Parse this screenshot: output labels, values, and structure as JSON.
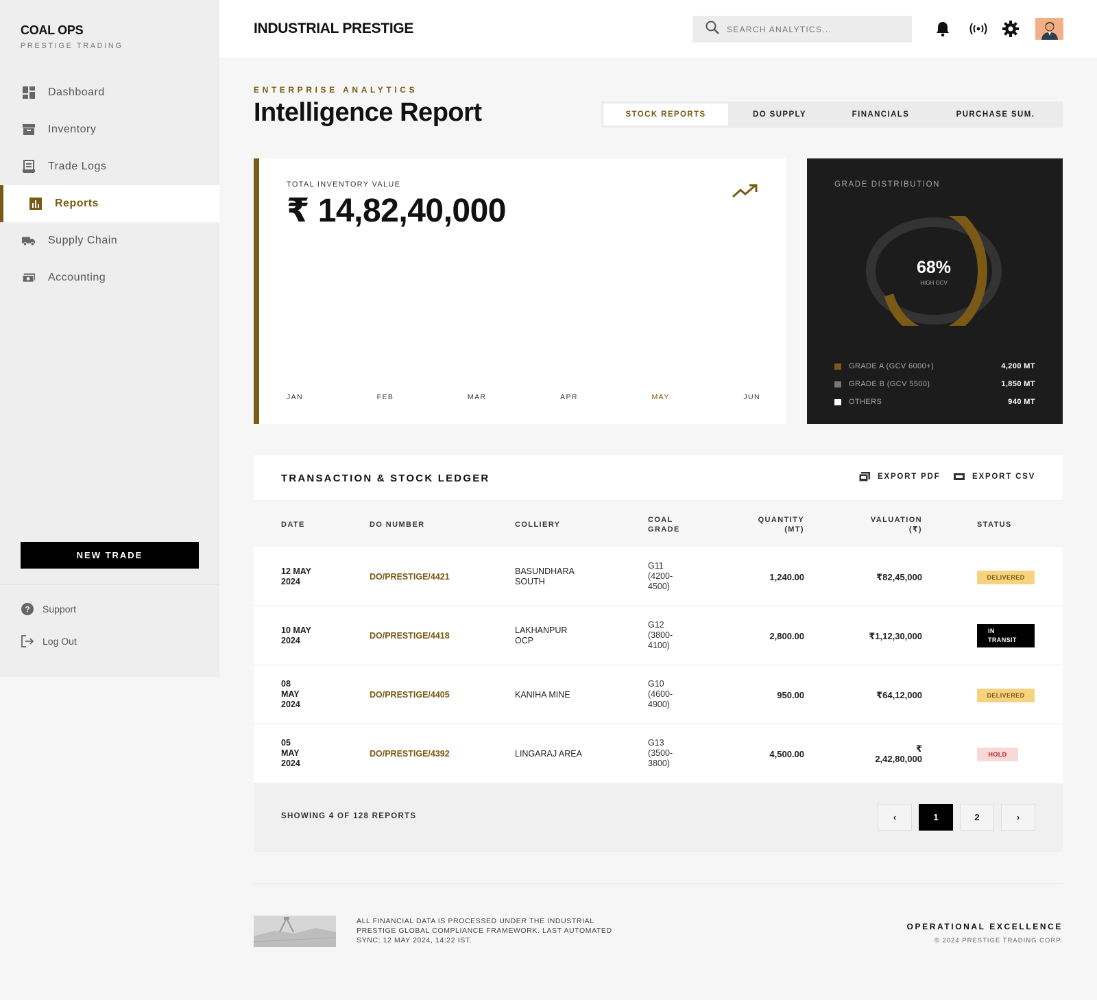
{
  "sidebar": {
    "brand_title": "COAL OPS",
    "brand_subtitle": "PRESTIGE TRADING",
    "items": [
      {
        "label": "Dashboard",
        "icon": "dashboard-icon"
      },
      {
        "label": "Inventory",
        "icon": "inventory-box-icon"
      },
      {
        "label": "Trade Logs",
        "icon": "receipt-icon"
      },
      {
        "label": "Reports",
        "icon": "bar-chart-icon",
        "active": true
      },
      {
        "label": "Supply Chain",
        "icon": "truck-icon"
      },
      {
        "label": "Accounting",
        "icon": "cash-icon"
      }
    ],
    "new_trade_label": "NEW TRADE",
    "support_label": "Support",
    "logout_label": "Log Out"
  },
  "header": {
    "title": "INDUSTRIAL PRESTIGE",
    "search_placeholder": "SEARCH ANALYTICS...",
    "icons": [
      "bell-icon",
      "broadcast-icon",
      "gear-icon",
      "avatar"
    ]
  },
  "page": {
    "eyebrow": "ENTERPRISE ANALYTICS",
    "title": "Intelligence Report",
    "tabs": [
      {
        "label": "STOCK REPORTS",
        "active": true
      },
      {
        "label": "DO SUPPLY"
      },
      {
        "label": "FINANCIALS"
      },
      {
        "label": "PURCHASE SUM."
      }
    ]
  },
  "kpi": {
    "label": "TOTAL INVENTORY VALUE",
    "value": "₹ 14,82,40,000",
    "months": [
      "JAN",
      "FEB",
      "MAR",
      "APR",
      "MAY",
      "JUN"
    ],
    "highlight_month": "MAY"
  },
  "grade_distribution": {
    "label": "GRADE DISTRIBUTION",
    "percent": "68%",
    "percent_value": 68,
    "percent_caption": "HIGH GCV",
    "legend": [
      {
        "label": "GRADE A (GCV 6000+)",
        "value": "4,200 MT",
        "color": "#7a5a14"
      },
      {
        "label": "GRADE B (GCV 5500)",
        "value": "1,850 MT",
        "color": "#777777"
      },
      {
        "label": "OTHERS",
        "value": "940 MT",
        "color": "#ffffff"
      }
    ]
  },
  "ledger": {
    "title": "TRANSACTION & STOCK LEDGER",
    "export_pdf": "EXPORT PDF",
    "export_csv": "EXPORT CSV",
    "columns": {
      "date": "DATE",
      "do_number": "DO NUMBER",
      "colliery": "COLLIERY",
      "coal_grade_1": "COAL",
      "coal_grade_2": "GRADE",
      "quantity_1": "QUANTITY",
      "quantity_2": "(MT)",
      "valuation_1": "VALUATION",
      "valuation_2": "(₹)",
      "status": "STATUS"
    },
    "rows": [
      {
        "date1": "12 MAY",
        "date2": "2024",
        "date3": "",
        "do": "DO/PRESTIGE/4421",
        "col1": "BASUNDHARA",
        "col2": "SOUTH",
        "g1": "G11",
        "g2": "(4200-",
        "g3": "4500)",
        "qty": "1,240.00",
        "val1": "₹82,45,000",
        "val2": "",
        "status": "DELIVERED",
        "status_type": "delivered"
      },
      {
        "date1": "10 MAY",
        "date2": "2024",
        "date3": "",
        "do": "DO/PRESTIGE/4418",
        "col1": "LAKHANPUR",
        "col2": "OCP",
        "g1": "G12",
        "g2": "(3800-",
        "g3": "4100)",
        "qty": "2,800.00",
        "val1": "₹1,12,30,000",
        "val2": "",
        "status1": "IN",
        "status2": "TRANSIT",
        "status_type": "transit"
      },
      {
        "date1": "08",
        "date2": "MAY",
        "date3": "2024",
        "do": "DO/PRESTIGE/4405",
        "col1": "KANIHA MINE",
        "col2": "",
        "g1": "G10",
        "g2": "(4600-",
        "g3": "4900)",
        "qty": "950.00",
        "val1": "₹64,12,000",
        "val2": "",
        "status": "DELIVERED",
        "status_type": "delivered"
      },
      {
        "date1": "05",
        "date2": "MAY",
        "date3": "2024",
        "do": "DO/PRESTIGE/4392",
        "col1": "LINGARAJ AREA",
        "col2": "",
        "g1": "G13",
        "g2": "(3500-",
        "g3": "3800)",
        "qty": "4,500.00",
        "val1": "₹",
        "val2": "2,42,80,000",
        "status": "HOLD",
        "status_type": "hold"
      }
    ],
    "showing": "SHOWING 4 OF 128 REPORTS",
    "pager": {
      "prev": "‹",
      "pages": [
        "1",
        "2"
      ],
      "active": "1",
      "next": "›"
    }
  },
  "footer": {
    "note": "ALL FINANCIAL DATA IS PROCESSED UNDER THE INDUSTRIAL PRESTIGE GLOBAL COMPLIANCE FRAMEWORK. LAST AUTOMATED SYNC: 12 MAY 2024, 14:22 IST.",
    "right_title": "OPERATIONAL EXCELLENCE",
    "copyright": "© 2024 PRESTIGE TRADING CORP."
  },
  "colors": {
    "accent": "#7a5a14",
    "dark_card": "#1c1c1c",
    "delivered_bg": "#f7d37f",
    "hold_bg": "#f9d8d8"
  }
}
